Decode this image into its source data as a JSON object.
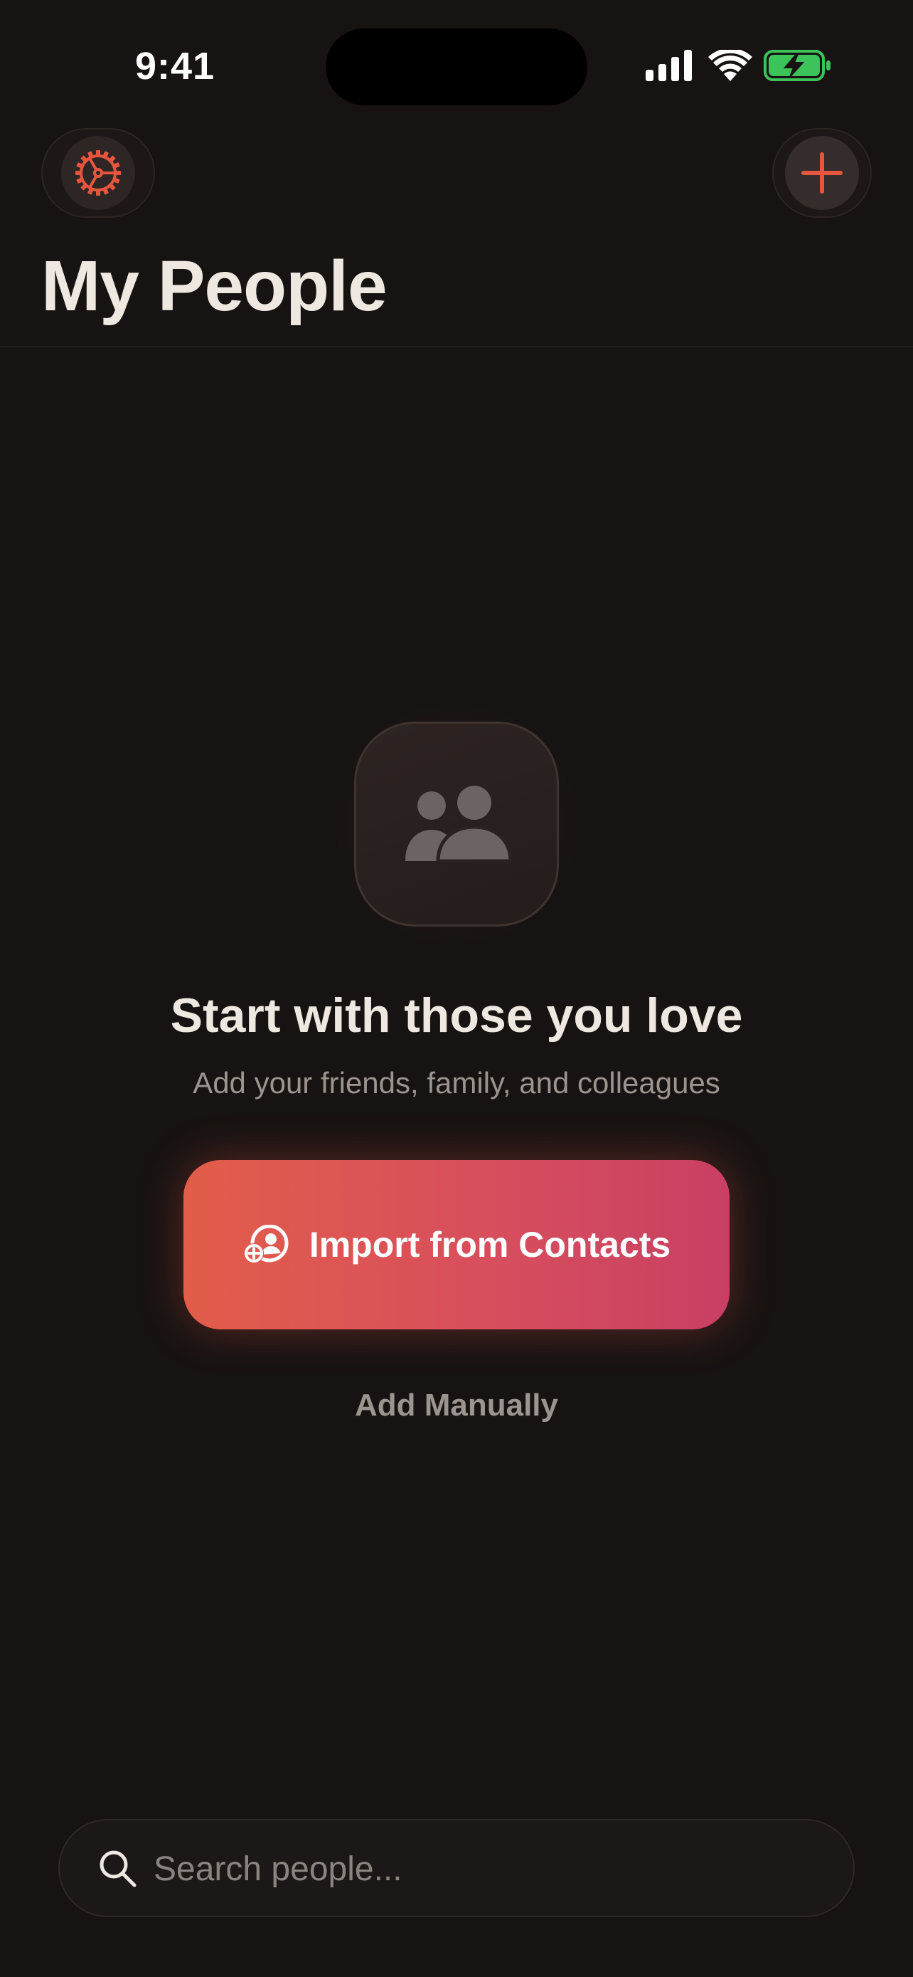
{
  "status_bar": {
    "time": "9:41"
  },
  "header": {
    "title": "My People",
    "settings_icon": "gear-icon",
    "add_icon": "plus-icon"
  },
  "empty_state": {
    "icon": "people-icon",
    "heading": "Start with those you love",
    "subtitle": "Add your friends, family, and colleagues",
    "import_button_label": "Import from Contacts",
    "import_icon": "add-contact-icon",
    "add_manually_label": "Add Manually"
  },
  "search": {
    "placeholder": "Search people...",
    "value": "",
    "icon": "search-icon"
  },
  "colors": {
    "background": "#171312",
    "accent": "#E35D4A",
    "accent_end": "#C83F63",
    "battery": "#3CC35A"
  }
}
